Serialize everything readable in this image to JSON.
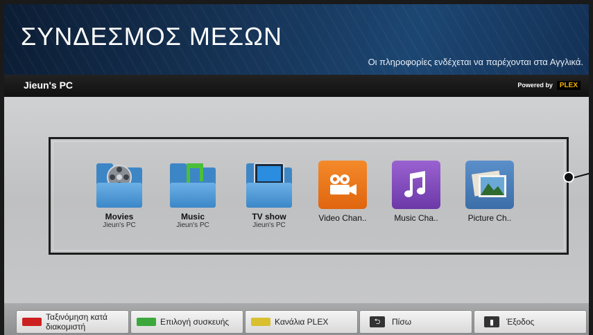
{
  "header": {
    "title": "ΣΥΝΔΕΣΜΟΣ ΜΕΣΩΝ",
    "subtitle": "Οι πληροφορίες ενδέχεται να παρέχονται στα Αγγλικά."
  },
  "device_bar": {
    "device_name": "Jieun's PC",
    "powered_by": "Powered by",
    "brand": "PLEX"
  },
  "tiles": [
    {
      "label": "Movies",
      "sublabel": "Jieun's PC",
      "icon": "film-reel-folder-icon"
    },
    {
      "label": "Music",
      "sublabel": "Jieun's PC",
      "icon": "music-note-folder-icon"
    },
    {
      "label": "TV show",
      "sublabel": "Jieun's PC",
      "icon": "tv-folder-icon"
    },
    {
      "label": "Video Chan..",
      "icon": "video-camera-icon",
      "color": "#e8711a"
    },
    {
      "label": "Music Cha..",
      "icon": "music-note-icon",
      "color": "#7d47b8"
    },
    {
      "label": "Picture Ch..",
      "icon": "picture-icon",
      "color": "#4a7fb8"
    }
  ],
  "buttons": {
    "red": "Ταξινόμηση κατά διακομιστή",
    "green": "Επιλογή συσκευής",
    "yellow": "Κανάλια PLEX",
    "back": "Πίσω",
    "exit": "Έξοδος"
  },
  "colors": {
    "red": "#cc2020",
    "green": "#3ca83c",
    "yellow": "#d8c030"
  }
}
